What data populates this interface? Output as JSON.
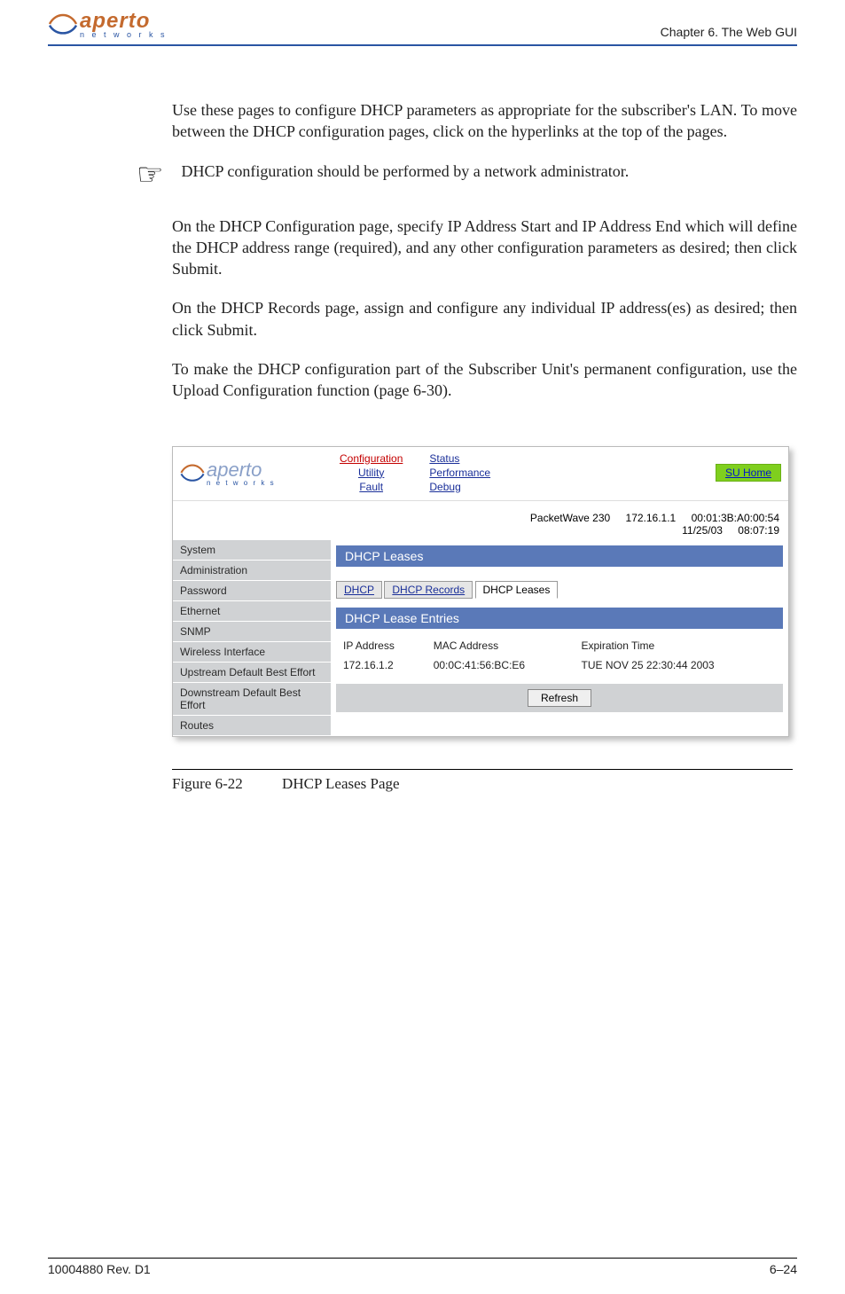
{
  "header": {
    "logo_text": "aperto",
    "logo_sub": "n e t w o r k s",
    "chapter_label": "Chapter 6.",
    "chapter_title": "The Web GUI"
  },
  "paragraphs": {
    "p1": "Use these pages to configure DHCP parameters as appropriate for the subscriber's LAN. To move between the DHCP configuration pages, click on the hyperlinks at the top of the pages.",
    "note": "DHCP configuration should be performed by a network administrator.",
    "p2": "On the DHCP Configuration page, specify IP Address Start and IP Address End which will define the DHCP address range (required), and any other configuration parameters as desired; then click Submit.",
    "p3": "On the DHCP Records page, assign and configure any individual IP address(es) as desired; then click Submit.",
    "p4a": "To make the DHCP configuration part of the Subscriber Unit's permanent configuration, use the Upload Configuration function (",
    "p4_ref": "page 6-30",
    "p4b": ")."
  },
  "screenshot": {
    "nav_left": [
      "Configuration",
      "Utility",
      "Fault"
    ],
    "nav_right": [
      "Status",
      "Performance",
      "Debug"
    ],
    "su_home": "SU Home",
    "device_info": {
      "model": "PacketWave 230",
      "ip": "172.16.1.1",
      "mac": "00:01:3B:A0:00:54",
      "date": "11/25/03",
      "time": "08:07:19"
    },
    "sidemenu": [
      "System",
      "Administration",
      "Password",
      "Ethernet",
      "SNMP",
      "Wireless Interface",
      "Upstream Default Best Effort",
      "Downstream Default Best Effort",
      "Routes"
    ],
    "panel1_title": "DHCP Leases",
    "tabs": [
      "DHCP",
      "DHCP Records",
      "DHCP Leases"
    ],
    "active_tab_index": 2,
    "panel2_title": "DHCP Lease Entries",
    "lease_headers": [
      "IP Address",
      "MAC Address",
      "Expiration Time"
    ],
    "lease_rows": [
      {
        "ip": "172.16.1.2",
        "mac": "00:0C:41:56:BC:E6",
        "exp": "TUE NOV 25 22:30:44 2003"
      }
    ],
    "refresh_label": "Refresh"
  },
  "figure": {
    "number": "Figure 6-22",
    "title": "DHCP Leases Page"
  },
  "footer": {
    "doc_id": "10004880 Rev. D1",
    "page_no": "6–24"
  }
}
